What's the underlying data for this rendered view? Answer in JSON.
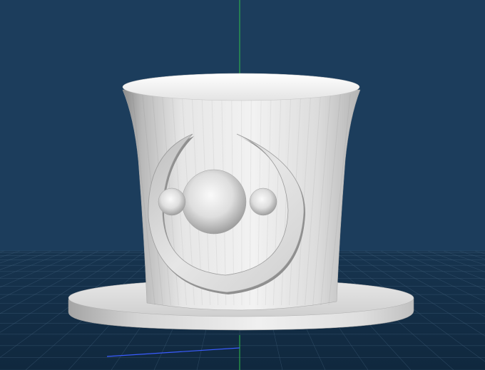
{
  "viewport": {
    "background_color": "#1c3d5c",
    "floor_color": "#142f49",
    "grid_color": "#3f5e7a",
    "axis_colors": {
      "vertical": "#2fbf4a",
      "depth": "#3a5cff"
    }
  },
  "model": {
    "object": "top-hat",
    "emblem": "crescent-with-three-spheres",
    "material_color": "#e2e2e2"
  }
}
